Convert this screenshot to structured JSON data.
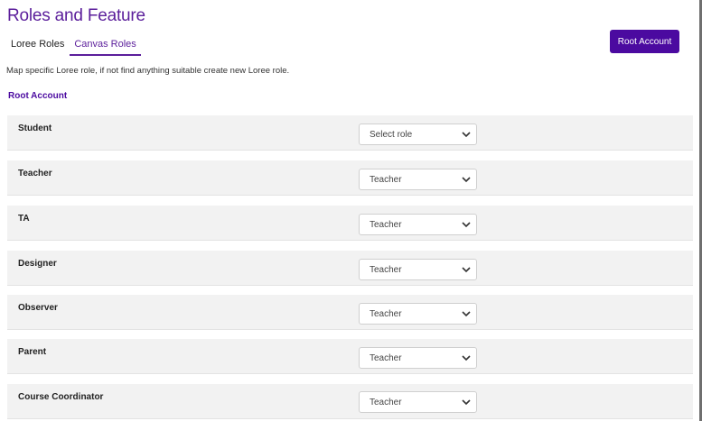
{
  "header": {
    "title": "Roles and Feature",
    "tabs": [
      {
        "label": "Loree Roles",
        "active": false
      },
      {
        "label": "Canvas Roles",
        "active": true
      }
    ],
    "root_button_label": "Root Account"
  },
  "main": {
    "description": "Map specific Loree role, if not find anything suitable create new Loree role.",
    "section_heading": "Root Account",
    "roles": [
      {
        "name": "Student",
        "selected": "Select role"
      },
      {
        "name": "Teacher",
        "selected": "Teacher"
      },
      {
        "name": "TA",
        "selected": "Teacher"
      },
      {
        "name": "Designer",
        "selected": "Teacher"
      },
      {
        "name": "Observer",
        "selected": "Teacher"
      },
      {
        "name": "Parent",
        "selected": "Teacher"
      },
      {
        "name": "Course Coordinator",
        "selected": "Teacher"
      }
    ]
  },
  "colors": {
    "accent": "#5b1e9b",
    "button": "#4b0aa0",
    "row_background": "#f2f2f2"
  },
  "icons": {
    "select_arrow": "chevron-down-icon"
  }
}
